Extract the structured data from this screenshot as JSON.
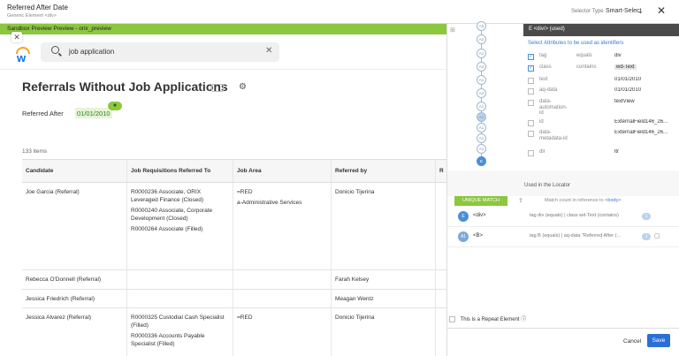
{
  "topbar": {
    "title": "Referred After Date",
    "subtitle": "Generic Element <div>",
    "selector_type_label": "Selector Type",
    "selector_type_value": "Smart-Select",
    "close_glyph": "✕"
  },
  "preview": {
    "bar_text": "Sandbox Preview Preview - orix_preview",
    "close_glyph": "✕",
    "accent_color": "#8dc63f"
  },
  "app": {
    "logo_letter": "w",
    "search_value": "job application",
    "search_clear": "✕",
    "page_title": "Referrals Without Job Applications",
    "more_glyph": "···",
    "config_glyph": "⚙",
    "param_label": "Referred After",
    "param_value": "01/01/2010",
    "pin_glyph": "●",
    "items_count": "133 items",
    "columns": [
      "Candidate",
      "Job Requisitions Referred To",
      "Job Area",
      "Referred by",
      "R"
    ],
    "rows": [
      {
        "candidate": "Joe Garcia (Referral)",
        "requisitions": [
          "R0000236 Associate, ORIX Leveraged Finance (Closed)",
          "R0000240 Associate, Corporate Development (Closed)",
          "R0000264 Associate (Filled)"
        ],
        "job_area": [
          "=RED",
          "a-Administrative Services"
        ],
        "referred_by": "Donicio Tijerina"
      },
      {
        "candidate": "Rebecca O'Donnell (Referral)",
        "requisitions": [],
        "job_area": [],
        "referred_by": "Farah Kelsey"
      },
      {
        "candidate": "Jessica Friedrich (Referral)",
        "requisitions": [],
        "job_area": [],
        "referred_by": "Meagan Wentz"
      },
      {
        "candidate": "Jessica Alvarez (Referral)",
        "requisitions": [
          "R0000325 Custodial Cash Specialist (Filled)",
          "R0000336 Accounts Payable Specialist (Filled)"
        ],
        "job_area": [
          "=RED"
        ],
        "referred_by": "Donicio Tijerina"
      }
    ]
  },
  "tree": {
    "panel_icon": "⊞",
    "nodes": [
      "A3",
      "A2",
      "A1",
      "A2",
      "A1",
      "A2",
      "A1",
      "A1",
      "A1",
      "A1",
      "A1",
      "A2",
      "A1",
      "E"
    ]
  },
  "attributes": {
    "header": "E  <div/> (used)",
    "subtitle": "Select Attributes to be used as identifiers",
    "rows": [
      {
        "name": "tag",
        "op": "equals",
        "value": "div",
        "checked": true
      },
      {
        "name": "class",
        "op": "contains",
        "value": "wd-Text",
        "checked": true
      },
      {
        "name": "text",
        "op": "",
        "value": "01/01/2010",
        "checked": false
      },
      {
        "name": "aq-data",
        "op": "",
        "value": "01/01/2010",
        "checked": false
      },
      {
        "name": "data-automation-id",
        "op": "",
        "value": "textView",
        "checked": false
      },
      {
        "name": "id",
        "op": "",
        "value": "ExternalField146_26...",
        "checked": false
      },
      {
        "name": "data-metadata-id",
        "op": "",
        "value": "ExternalField146_26...",
        "checked": false
      },
      {
        "name": "dir",
        "op": "",
        "value": "ltr",
        "checked": false
      }
    ]
  },
  "locator": {
    "used_label": "Used in the Locator",
    "unique_badge": "UNIQUE MATCH",
    "export_glyph": "⇪",
    "match_text": "Match count in reference to",
    "match_ref": "<body>",
    "rows": [
      {
        "badge": "E",
        "tag": "<div>",
        "desc": "tag div (equals) | class wd-Text (contains)",
        "count": "1"
      },
      {
        "badge": "A1",
        "tag": "<B>",
        "desc": "tag B (equals) | aq-data \"Referred After (...",
        "count": "1"
      }
    ]
  },
  "footer": {
    "repeat_label": "This is a Repeat Element",
    "repeat_help": "?",
    "cancel": "Cancel",
    "save": "Save"
  }
}
